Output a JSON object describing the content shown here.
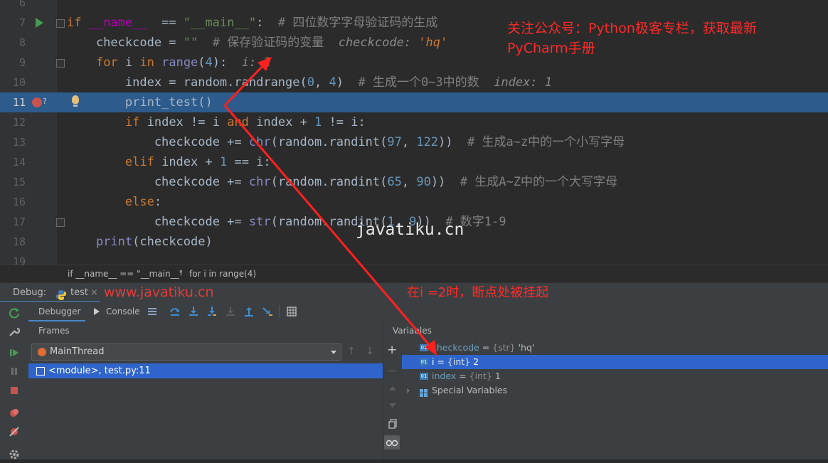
{
  "editor": {
    "lines": [
      {
        "n": "6",
        "tokens": []
      },
      {
        "n": "7",
        "tokens": [
          [
            "kw",
            "if "
          ],
          [
            "dun",
            "__name__"
          ],
          [
            "",
            "  == "
          ],
          [
            "str",
            "\"__main__\""
          ],
          [
            "",
            ":  "
          ],
          [
            "cm",
            "# 四位数字字母验证码的生成"
          ]
        ]
      },
      {
        "n": "8",
        "tokens": [
          [
            "",
            "    checkcode = "
          ],
          [
            "str",
            "\"\""
          ],
          [
            "",
            "  "
          ],
          [
            "cm",
            "# 保存验证码的变量  "
          ],
          [
            "hint",
            "checkcode: "
          ],
          [
            "hv",
            "'hq'"
          ]
        ]
      },
      {
        "n": "9",
        "tokens": [
          [
            "",
            "    "
          ],
          [
            "kw",
            "for "
          ],
          [
            "",
            "i "
          ],
          [
            "kw",
            "in "
          ],
          [
            "bi",
            "range"
          ],
          [
            "",
            "("
          ],
          [
            "num",
            "4"
          ],
          [
            "",
            "):  "
          ],
          [
            "hint",
            "i: "
          ],
          [
            "hv",
            "2"
          ]
        ]
      },
      {
        "n": "10",
        "tokens": [
          [
            "",
            "        index = random.randrange("
          ],
          [
            "num",
            "0"
          ],
          [
            "",
            ", "
          ],
          [
            "num",
            "4"
          ],
          [
            "",
            ")  "
          ],
          [
            "cm",
            "# 生成一个0~3中的数  "
          ],
          [
            "hint",
            "index: 1"
          ]
        ]
      },
      {
        "n": "11",
        "tokens": [
          [
            "",
            "        print_test()"
          ]
        ]
      },
      {
        "n": "12",
        "tokens": [
          [
            "",
            "        "
          ],
          [
            "kw",
            "if "
          ],
          [
            "",
            "index != i "
          ],
          [
            "kw",
            "and "
          ],
          [
            "",
            "index + "
          ],
          [
            "num",
            "1"
          ],
          [
            "",
            " != i:"
          ]
        ]
      },
      {
        "n": "13",
        "tokens": [
          [
            "",
            "            checkcode += "
          ],
          [
            "bi",
            "chr"
          ],
          [
            "",
            "(random.randint("
          ],
          [
            "num",
            "97"
          ],
          [
            "",
            ", "
          ],
          [
            "num",
            "122"
          ],
          [
            "",
            "))  "
          ],
          [
            "cm",
            "# 生成a~z中的一个小写字母"
          ]
        ]
      },
      {
        "n": "14",
        "tokens": [
          [
            "",
            "        "
          ],
          [
            "kw",
            "elif "
          ],
          [
            "",
            "index + "
          ],
          [
            "num",
            "1"
          ],
          [
            "",
            " == i:"
          ]
        ]
      },
      {
        "n": "15",
        "tokens": [
          [
            "",
            "            checkcode += "
          ],
          [
            "bi",
            "chr"
          ],
          [
            "",
            "(random.randint("
          ],
          [
            "num",
            "65"
          ],
          [
            "",
            ", "
          ],
          [
            "num",
            "90"
          ],
          [
            "",
            "))  "
          ],
          [
            "cm",
            "# 生成A~Z中的一个大写字母"
          ]
        ]
      },
      {
        "n": "16",
        "tokens": [
          [
            "",
            "        "
          ],
          [
            "kw",
            "else"
          ],
          [
            "",
            ":"
          ]
        ]
      },
      {
        "n": "17",
        "tokens": [
          [
            "",
            "            checkcode += "
          ],
          [
            "bi",
            "str"
          ],
          [
            "",
            "(random.randint("
          ],
          [
            "num",
            "1"
          ],
          [
            "",
            ", "
          ],
          [
            "num",
            "9"
          ],
          [
            "",
            "))  "
          ],
          [
            "cm",
            "# 数字1-9"
          ]
        ]
      },
      {
        "n": "18",
        "tokens": [
          [
            "",
            "    "
          ],
          [
            "bi",
            "print"
          ],
          [
            "",
            "(checkcode)"
          ]
        ]
      },
      {
        "n": "19",
        "tokens": []
      }
    ]
  },
  "annotations": {
    "promo_line1": "关注公众号：Python极客专栏，获取最新",
    "promo_line2": "PyCharm手册",
    "suspended_note": "在i =2时，断点处被挂起",
    "watermark_center": "javatiku.cn",
    "watermark_left": "www.javatiku.cn"
  },
  "breadcrumb": {
    "item1": "if __name__ == \"__main__\"",
    "sep": "›",
    "item2": "for i in range(4)"
  },
  "debug": {
    "label": "Debug:",
    "config_tab": "test",
    "tab_debugger": "Debugger",
    "tab_console": "Console",
    "frames_title": "Frames",
    "variables_title": "Variables",
    "thread": "MainThread",
    "frame": "<module>, test.py:11",
    "variables": [
      {
        "name": "checkcode",
        "type": "{str}",
        "value": "'hq'"
      },
      {
        "name": "i",
        "type": "{int}",
        "value": "2"
      },
      {
        "name": "index",
        "type": "{int}",
        "value": "1"
      }
    ],
    "special_variables": "Special Variables"
  },
  "colors": {
    "editor_bg": "#2b2b2b",
    "current_line": "#2d5b8c",
    "selection": "#2f65ca",
    "annotation": "#ff2a2a",
    "keyword": "#cc7832",
    "number": "#6897bb",
    "comment": "#808080"
  }
}
